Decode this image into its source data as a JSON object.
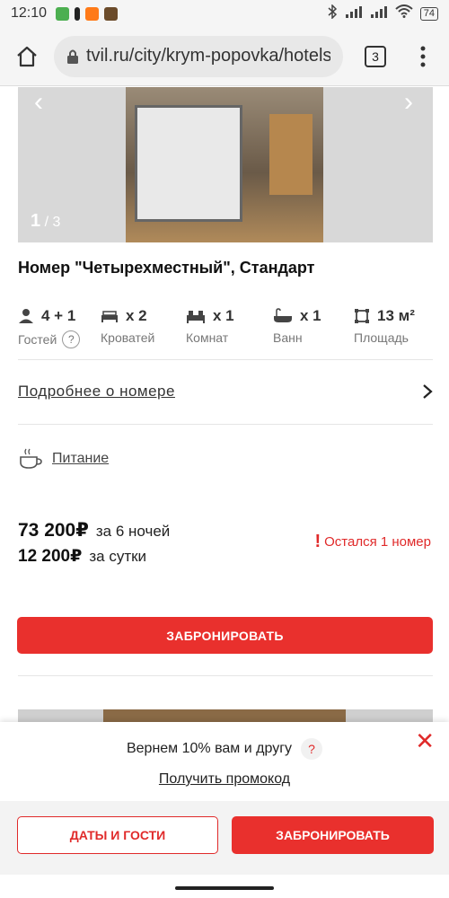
{
  "status_bar": {
    "time": "12:10",
    "battery": "74"
  },
  "browser": {
    "url": "tvil.ru/city/krym-popovka/hotels",
    "tabs_count": "3"
  },
  "gallery": {
    "current": "1",
    "separator": " / ",
    "total": "3"
  },
  "room": {
    "title": "Номер \"Четырехместный\", Стандарт",
    "amenities": [
      {
        "icon": "person-icon",
        "value": "4 + 1",
        "label": "Гостей"
      },
      {
        "icon": "bed-icon",
        "value": "x 2",
        "label": "Кроватей"
      },
      {
        "icon": "rooms-icon",
        "value": "x 1",
        "label": "Комнат"
      },
      {
        "icon": "bathtub-icon",
        "value": "x 1",
        "label": "Ванн"
      },
      {
        "icon": "area-icon",
        "value": "13 м²",
        "label": "Площадь"
      }
    ],
    "guests_help": "?",
    "details_link": "Подробнее о номере",
    "meals_link": "Питание"
  },
  "price": {
    "total": "73 200₽",
    "total_period": "за 6 ночей",
    "per_day": "12 200₽",
    "per_day_period": "за сутки",
    "availability": "Остался 1 номер"
  },
  "book_button": "ЗАБРОНИРОВАТЬ",
  "promo": {
    "text": "Вернем 10% вам и другу",
    "help": "?",
    "link": "Получить промокод",
    "close": "✕"
  },
  "bottom_bar": {
    "dates_button": "ДАТЫ И ГОСТИ",
    "book_button": "ЗАБРОНИРОВАТЬ"
  },
  "colors": {
    "accent": "#e9302d",
    "text": "#222222",
    "muted": "#777777"
  }
}
